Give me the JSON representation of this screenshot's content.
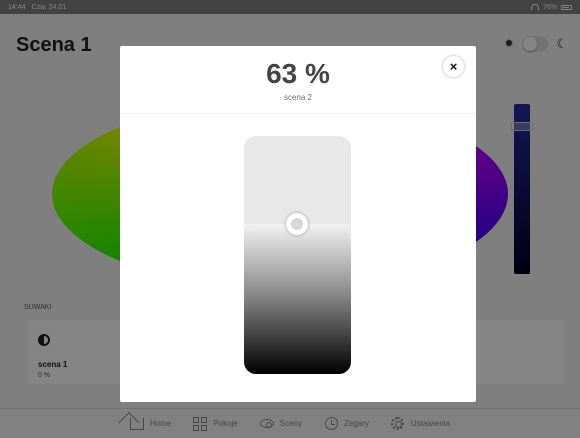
{
  "status_bar": {
    "time": "14:44",
    "date": "Czw. 24.01",
    "battery": "76%"
  },
  "page": {
    "title": "Scena 1"
  },
  "section": {
    "label": "SUWAKI"
  },
  "scene_card": {
    "name": "scena 1",
    "value": "0 %",
    "right_text": "s"
  },
  "tabs": [
    {
      "label": "Home",
      "icon": "home-icon"
    },
    {
      "label": "Pokoje",
      "icon": "grid-icon"
    },
    {
      "label": "Sceny",
      "icon": "eye-icon"
    },
    {
      "label": "Zegary",
      "icon": "clock-icon"
    },
    {
      "label": "Ustawienia",
      "icon": "gear-icon"
    }
  ],
  "modal": {
    "value_text": "63 %",
    "subtitle": "scena 2",
    "level": 0.63,
    "close_symbol": "×"
  }
}
